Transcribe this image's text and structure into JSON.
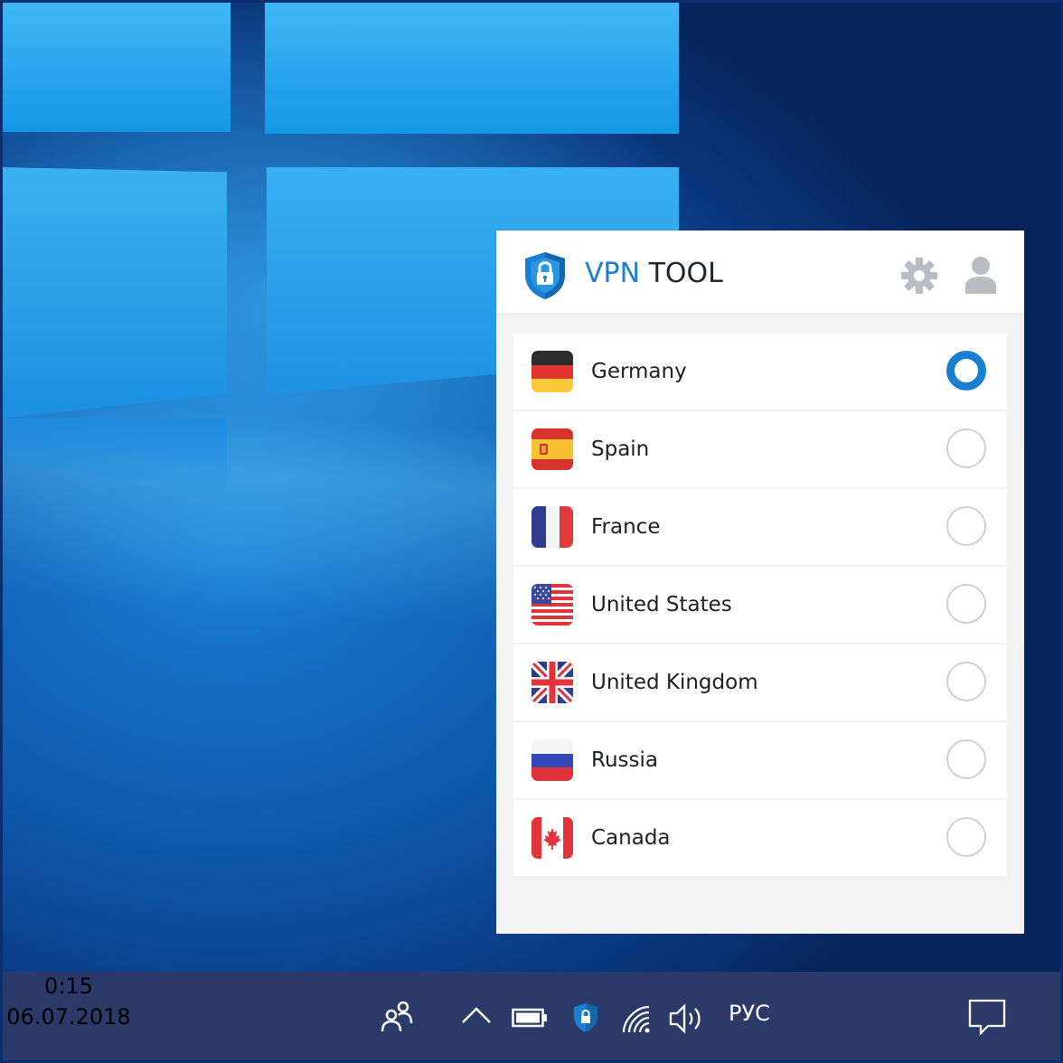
{
  "vpn_window": {
    "title_vpn": "VPN",
    "title_tool": "TOOL",
    "icons": {
      "logo": "shield-lock-icon",
      "settings": "gear-icon",
      "account": "user-icon"
    },
    "accent_color": "#1a7fd0",
    "servers": [
      {
        "country": "Germany",
        "flag": "germany-flag-icon",
        "selected": true
      },
      {
        "country": "Spain",
        "flag": "spain-flag-icon",
        "selected": false
      },
      {
        "country": "France",
        "flag": "france-flag-icon",
        "selected": false
      },
      {
        "country": "United States",
        "flag": "united-states-flag-icon",
        "selected": false
      },
      {
        "country": "United Kingdom",
        "flag": "united-kingdom-flag-icon",
        "selected": false
      },
      {
        "country": "Russia",
        "flag": "russia-flag-icon",
        "selected": false
      },
      {
        "country": "Canada",
        "flag": "canada-flag-icon",
        "selected": false
      }
    ]
  },
  "taskbar": {
    "icons": [
      "people-icon",
      "chevron-up-icon",
      "battery-icon",
      "vpn-shield-icon",
      "wifi-icon",
      "speaker-icon",
      "notification-icon"
    ],
    "language": "РУС",
    "time": "0:15",
    "date": "06.07.2018",
    "color": "#2b3a68"
  }
}
